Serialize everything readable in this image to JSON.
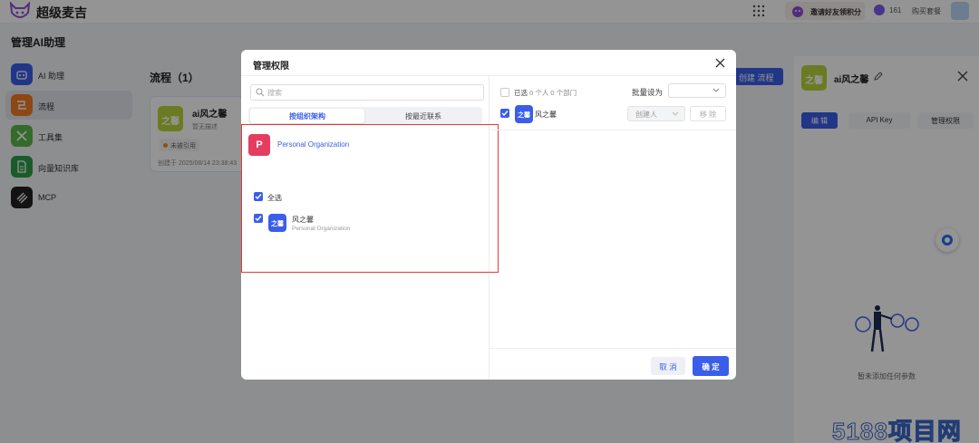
{
  "app": {
    "brand": "超级麦吉",
    "invite_label": "邀请好友领积分",
    "points": "161",
    "buy_label": "购买套餐"
  },
  "page": {
    "title": "管理AI助理"
  },
  "nav": {
    "items": [
      {
        "label": "AI 助理",
        "color": "#3b5ee8"
      },
      {
        "label": "流程",
        "color": "#f07a24"
      },
      {
        "label": "工具集",
        "color": "#5bb84a"
      },
      {
        "label": "向量知识库",
        "color": "#2e9d4a"
      },
      {
        "label": "MCP",
        "color": "#222222"
      }
    ]
  },
  "flows": {
    "title": "流程（1）",
    "create_label": "创建 流程",
    "card": {
      "avatar": "之馨",
      "name": "ai风之馨",
      "desc": "暂无描述",
      "tag": "未被引用",
      "created": "创建于 2025/08/14 23:38:43"
    }
  },
  "right_panel": {
    "avatar": "之馨",
    "name": "ai风之馨",
    "tabs": [
      "编 辑",
      "API Key",
      "管理权限"
    ],
    "empty_text": "暂未添加任何参数"
  },
  "modal": {
    "title": "管理权限",
    "search_placeholder": "搜索",
    "tabs": [
      "按组织架构",
      "按最近联系"
    ],
    "org": {
      "initial": "P",
      "name": "Personal Organization"
    },
    "select_all": "全选",
    "member": {
      "avatar": "之馨",
      "name": "风之馨",
      "org": "Personal Organization"
    },
    "right": {
      "selected_label": "已选",
      "selected_counts": "0 个人  0 个部门",
      "batch_label": "批量设为",
      "row": {
        "avatar": "之馨",
        "name": "风之馨",
        "role": "创建人",
        "remove": "移 除"
      }
    },
    "cancel_label": "取 消",
    "ok_label": "确 定"
  },
  "watermark": "5188项目网",
  "colors": {
    "accent": "#3b5ee8",
    "highlight": "#e53935",
    "org_avatar": "#e63c60"
  }
}
